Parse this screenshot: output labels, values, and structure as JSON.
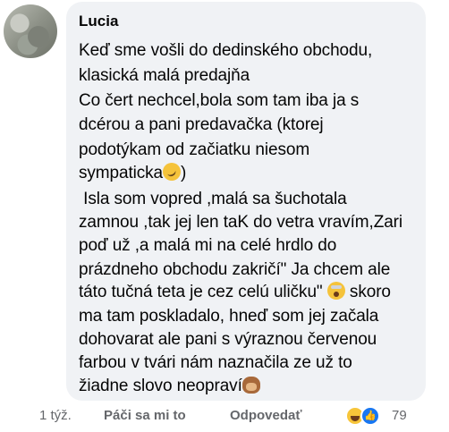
{
  "comment": {
    "author": "Lucia",
    "lines": [
      "Keď sme vošli do dedinského obchodu,",
      "klasická malá predajňa",
      "Co čert nechcel,bola som tam iba ja s",
      "dcérou a pani predavačka (ktorej",
      "podotýkam od začiatku niesom",
      "sympaticka",
      ")",
      " Isla som vopred ,malá sa šuchotala",
      "zamnou ,tak jej len taK do vetra vravím,Zari",
      "poď už ,a malá mi na celé hrdlo do",
      "prázdneho obchodu zakričí\" Ja chcem ale",
      "táto tučná teta je cez celú uličku\" ",
      " skoro",
      "ma tam poskladalo, hneď som jej začala",
      "dohovarat ale pani s výraznou červenou",
      "farbou v tvári nám naznačila ze už to",
      "žiadne slovo neopraví"
    ]
  },
  "footer": {
    "time": "1 týž.",
    "like_label": "Páči sa mi to",
    "reply_label": "Odpovedať",
    "reaction_count": "79"
  },
  "icons": {
    "reaction_1": "haha-reaction-icon",
    "reaction_2": "like-reaction-icon"
  }
}
